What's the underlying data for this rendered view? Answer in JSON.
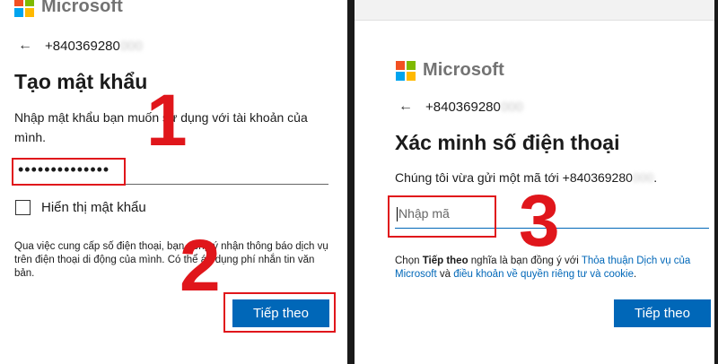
{
  "colors": {
    "accent": "#0067b8",
    "annotation": "#e0161b",
    "ms_red": "#f25022",
    "ms_green": "#7fba00",
    "ms_blue": "#00a4ef",
    "ms_yellow": "#ffb900"
  },
  "left": {
    "logo_text": "Microsoft",
    "phone_number": "+840369280",
    "title": "Tạo mật khẩu",
    "description": "Nhập mật khẩu bạn muốn sử dụng với tài khoản của mình.",
    "password_value": "••••••••••••••",
    "show_password_label": "Hiển thị mật khẩu",
    "disclaimer": "Qua việc cung cấp số điện thoại, bạn đồng ý nhận thông báo dịch vụ trên điện thoại di động của mình. Có thể áp dụng phí nhắn tin văn bản.",
    "next_button": "Tiếp theo"
  },
  "right": {
    "logo_text": "Microsoft",
    "phone_number": "+840369280",
    "title": "Xác minh số điện thoại",
    "description": "Chúng tôi vừa gửi một mã tới +840369280",
    "code_placeholder": "Nhập mã",
    "terms": {
      "prefix": "Chọn ",
      "bold": "Tiếp theo",
      "middle": " nghĩa là bạn đồng ý với ",
      "link1": "Thỏa thuận Dịch vụ của Microsoft",
      "and": " và ",
      "link2": "điều khoản về quyền riêng tư và cookie",
      "suffix": "."
    },
    "next_button": "Tiếp theo"
  },
  "annotations": {
    "step1": "1",
    "step2": "2",
    "step3": "3"
  }
}
